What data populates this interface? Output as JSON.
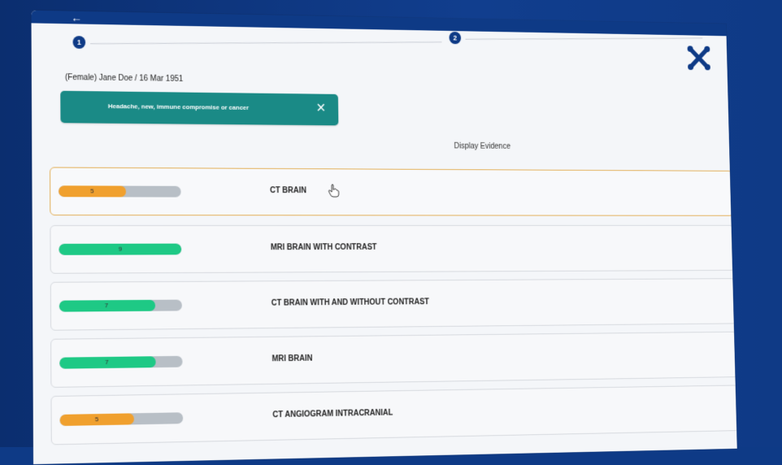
{
  "patient": "(Female) Jane Doe / 16 Mar 1951",
  "steps": [
    "1",
    "2"
  ],
  "chip": {
    "label": "Headache, new, immune compromise or cancer",
    "close": "✕"
  },
  "display_evidence": "Display Evidence",
  "colors": {
    "nav": "#0e3a86",
    "chip": "#1a8a86",
    "green": "#1ec985",
    "orange": "#f0a02e",
    "track": "#b8bfc6",
    "selected_border": "#e2ae55"
  },
  "rows": [
    {
      "label": "CT BRAIN",
      "score": "5",
      "fill": 0.55,
      "color": "orange",
      "selected": true
    },
    {
      "label": "MRI BRAIN WITH CONTRAST",
      "score": "9",
      "fill": 1.0,
      "color": "green",
      "selected": false
    },
    {
      "label": "CT BRAIN WITH AND WITHOUT CONTRAST",
      "score": "7",
      "fill": 0.78,
      "color": "green",
      "selected": false
    },
    {
      "label": "MRI BRAIN",
      "score": "7",
      "fill": 0.78,
      "color": "green",
      "selected": false
    },
    {
      "label": "CT ANGIOGRAM INTRACRANIAL",
      "score": "5",
      "fill": 0.6,
      "color": "orange",
      "selected": false
    }
  ]
}
